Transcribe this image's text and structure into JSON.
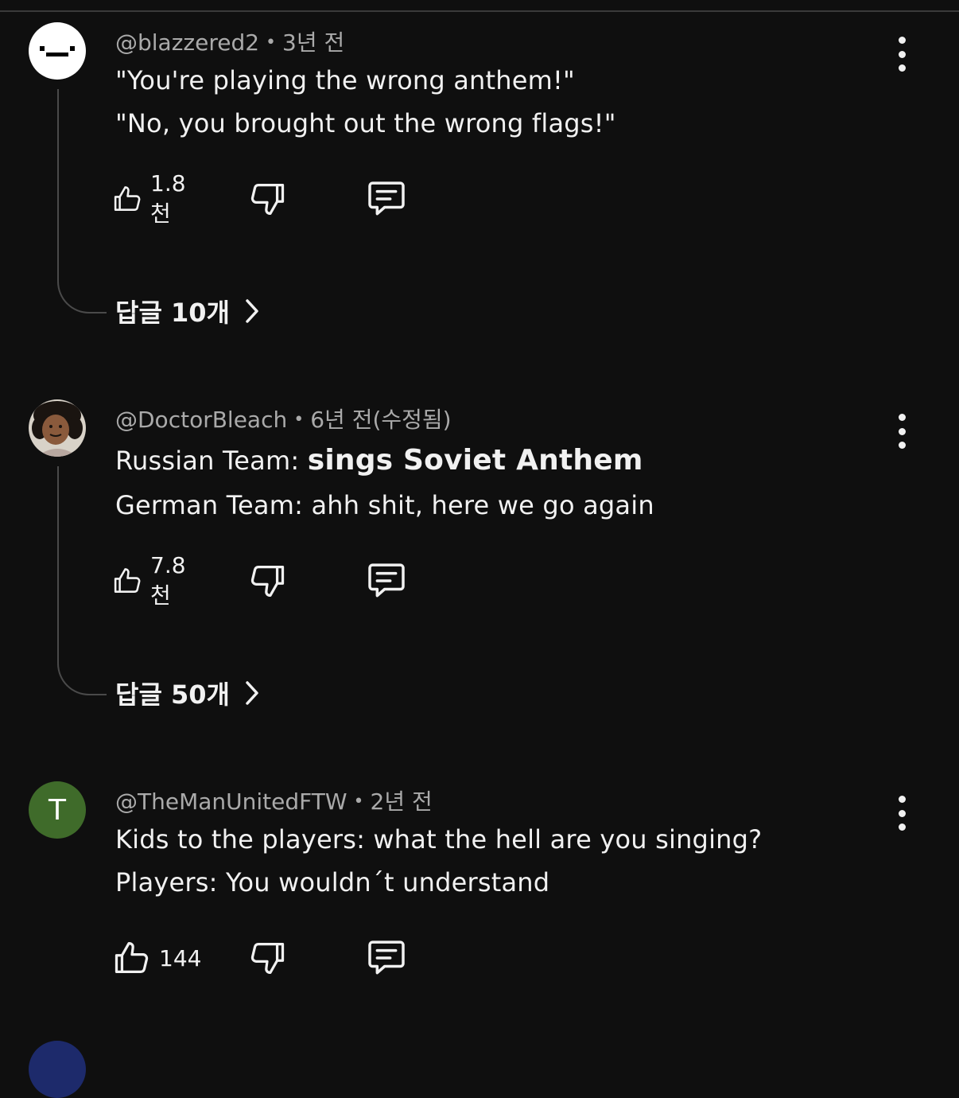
{
  "comments": [
    {
      "author": "@blazzered2",
      "time": "3년 전",
      "lines": [
        "\"You're playing the wrong anthem!\"",
        "\"No, you brought out the wrong flags!\""
      ],
      "likes": "1.8천",
      "replies_label": "답글 10개"
    },
    {
      "author": "@DoctorBleach",
      "time": "6년 전(수정됨)",
      "line1_prefix": "Russian Team: ",
      "line1_bold": "sings Soviet Anthem",
      "line2": "German Team: ahh shit, here we go again",
      "likes": "7.8천",
      "replies_label": "답글 50개"
    },
    {
      "author": "@TheManUnitedFTW",
      "avatar_letter": "T",
      "time": "2년 전",
      "lines": [
        "Kids to the players: what the hell are you singing?",
        "Players: You wouldn´t understand"
      ],
      "likes": "144"
    }
  ],
  "colors": {
    "background": "#0f0f0f",
    "text": "#f1f1f1",
    "meta": "#aaaaaa",
    "avatar_t": "#3f6b2a"
  },
  "icons": [
    "like-icon",
    "dislike-icon",
    "reply-icon",
    "more-icon",
    "chevron-right-icon"
  ]
}
